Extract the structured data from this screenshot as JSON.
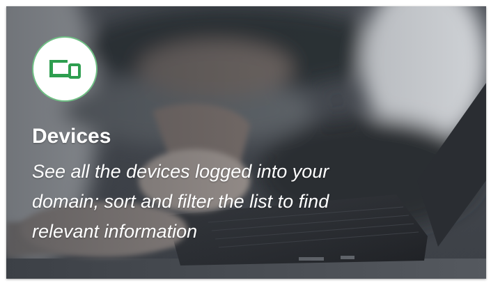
{
  "card": {
    "title": "Devices",
    "description": "See all the devices logged into your domain; sort and filter the list to find relevant information",
    "icon": "devices-icon",
    "accent_color": "#2e9e4f"
  }
}
